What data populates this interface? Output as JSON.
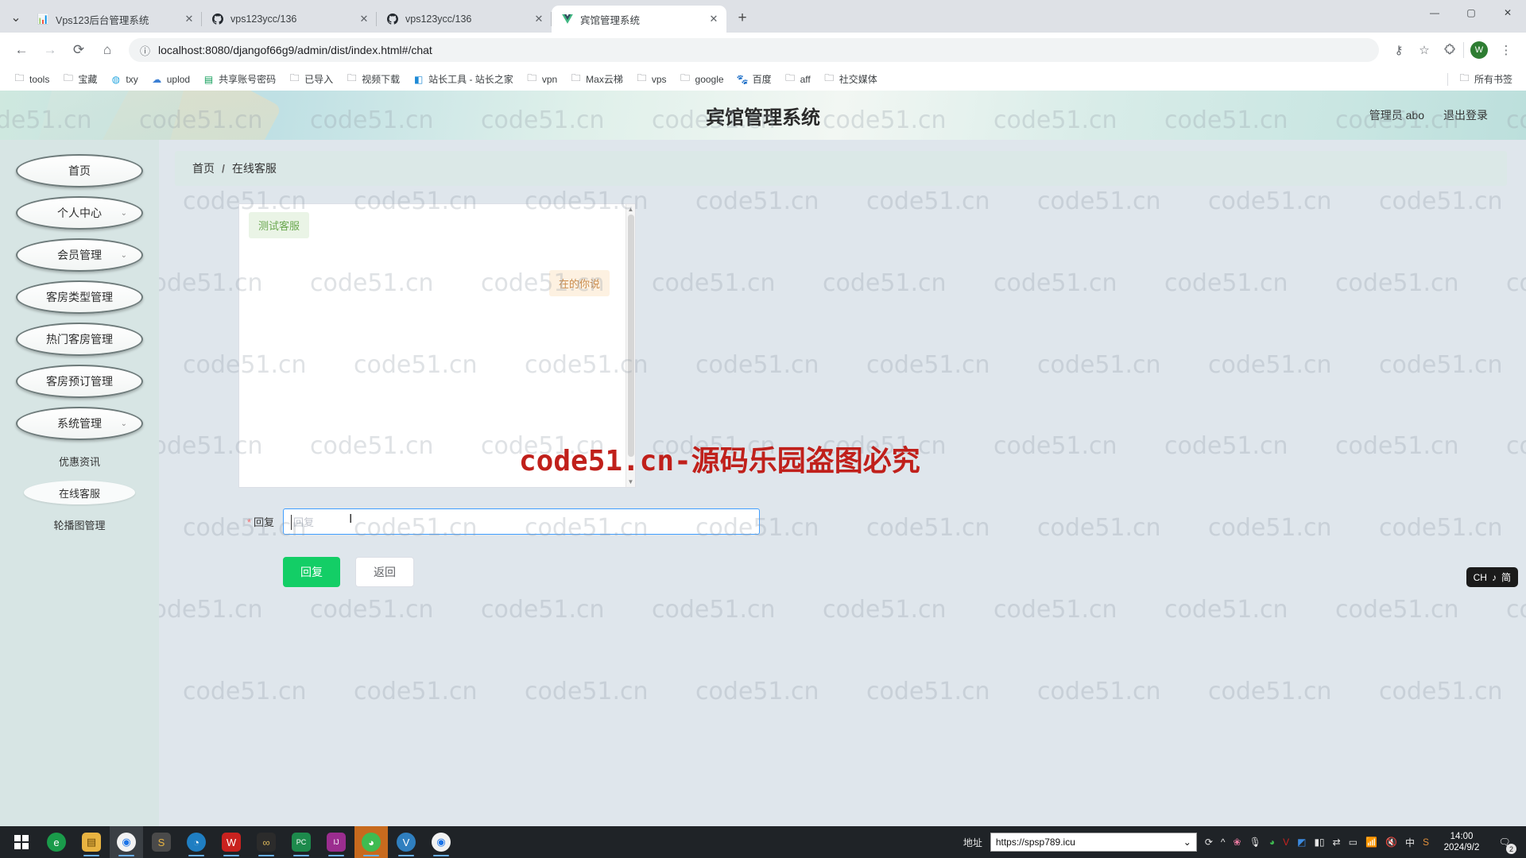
{
  "browser": {
    "tabs": [
      {
        "title": "Vps123后台管理系统",
        "favicon": "chart-icon",
        "active": false,
        "close": "✕"
      },
      {
        "title": "vps123ycc/136",
        "favicon": "github-icon",
        "active": false,
        "close": "✕"
      },
      {
        "title": "vps123ycc/136",
        "favicon": "github-icon",
        "active": false,
        "close": "✕"
      },
      {
        "title": "宾馆管理系统",
        "favicon": "vue-icon",
        "active": true,
        "close": "✕"
      }
    ],
    "new_tab_label": "+",
    "window_controls": {
      "minimize": "—",
      "maximize": "▢",
      "close": "✕"
    },
    "nav": {
      "back": "←",
      "forward": "→",
      "reload": "⟳",
      "home": "⌂"
    },
    "omnibox": {
      "info_icon": "ⓘ",
      "url": "localhost:8080/djangof66g9/admin/dist/index.html#/chat"
    },
    "toolbar_right": {
      "password_icon": "⚷",
      "bookmark_icon": "☆",
      "extensions_icon": "🧩",
      "profile_initial": "W",
      "menu_icon": "⋮"
    },
    "bookmarks": [
      {
        "label": "tools",
        "icon": "folder-icon"
      },
      {
        "label": "宝藏",
        "icon": "folder-icon"
      },
      {
        "label": "txy",
        "icon": "tencent-icon"
      },
      {
        "label": "uplod",
        "icon": "cloud-icon"
      },
      {
        "label": "共享账号密码",
        "icon": "sheet-icon"
      },
      {
        "label": "已导入",
        "icon": "folder-icon"
      },
      {
        "label": "视频下载",
        "icon": "folder-icon"
      },
      {
        "label": "站长工具 - 站长之家",
        "icon": "chinaz-icon"
      },
      {
        "label": "vpn",
        "icon": "folder-icon"
      },
      {
        "label": "Max云梯",
        "icon": "folder-icon"
      },
      {
        "label": "vps",
        "icon": "folder-icon"
      },
      {
        "label": "google",
        "icon": "folder-icon"
      },
      {
        "label": "百度",
        "icon": "baidu-icon"
      },
      {
        "label": "aff",
        "icon": "folder-icon"
      },
      {
        "label": "社交媒体",
        "icon": "folder-icon"
      }
    ],
    "all_bookmarks": {
      "label": "所有书签",
      "icon": "folder-icon"
    }
  },
  "app": {
    "header": {
      "title": "宾馆管理系统",
      "user_label": "管理员 abo",
      "logout_label": "退出登录"
    },
    "sidebar": {
      "items": [
        {
          "label": "首页",
          "has_arrow": false
        },
        {
          "label": "个人中心",
          "has_arrow": true
        },
        {
          "label": "会员管理",
          "has_arrow": true
        },
        {
          "label": "客房类型管理",
          "has_arrow": false
        },
        {
          "label": "热门客房管理",
          "has_arrow": false
        },
        {
          "label": "客房预订管理",
          "has_arrow": false
        },
        {
          "label": "系统管理",
          "has_arrow": true
        }
      ],
      "sub_items": [
        {
          "label": "优惠资讯",
          "active": false
        },
        {
          "label": "在线客服",
          "active": true
        },
        {
          "label": "轮播图管理",
          "active": false
        }
      ],
      "arrow_glyph": "⌄"
    },
    "breadcrumb": {
      "home": "首页",
      "separator": "/",
      "current": "在线客服"
    },
    "chat": {
      "messages": [
        {
          "text": "测试客服",
          "side": "left"
        },
        {
          "text": "在的你说",
          "side": "right"
        }
      ],
      "scroll_up": "▲",
      "scroll_down": "▼"
    },
    "form": {
      "required_mark": "*",
      "reply_label": "回复",
      "reply_placeholder": "回复",
      "reply_value": "",
      "submit_label": "回复",
      "back_label": "返回"
    },
    "watermark": {
      "tile_text": "code51.cn",
      "red_text": "code51.cn-源码乐园盗图必究"
    },
    "ime_badge": {
      "lang": "CH",
      "music": "♪",
      "mode": "简"
    }
  },
  "taskbar": {
    "start_icon": "windows-icon",
    "apps": [
      {
        "name": "ie-icon",
        "glyph": "e",
        "bg": "#1a9b4a",
        "open": false,
        "highlight": false
      },
      {
        "name": "explorer-icon",
        "glyph": "🗂",
        "bg": "#e8b341",
        "open": true,
        "highlight": false
      },
      {
        "name": "chrome-icon",
        "glyph": "◉",
        "bg": "#f2f2f2",
        "open": true,
        "highlight": true
      },
      {
        "name": "sublime-icon",
        "glyph": "S",
        "bg": "#4a4a4a",
        "open": false,
        "highlight": false
      },
      {
        "name": "edge-icon",
        "glyph": "◔",
        "bg": "#1f7ec2",
        "open": true,
        "highlight": false
      },
      {
        "name": "wps-icon",
        "glyph": "W",
        "bg": "#c9221f",
        "open": true,
        "highlight": false
      },
      {
        "name": "navicat-icon",
        "glyph": "∞",
        "bg": "#2b2b2b",
        "open": true,
        "highlight": false
      },
      {
        "name": "pycharm-icon",
        "glyph": "PC",
        "bg": "#1d8a4c",
        "open": true,
        "highlight": false
      },
      {
        "name": "idea-icon",
        "glyph": "IJ",
        "bg": "#9b2d8f",
        "open": true,
        "highlight": false
      },
      {
        "name": "wechat-icon",
        "glyph": "💬",
        "bg": "#3fbb51",
        "open": true,
        "highlight": true
      },
      {
        "name": "yy-icon",
        "glyph": "V",
        "bg": "#2f7fbf",
        "open": true,
        "highlight": false
      },
      {
        "name": "chrome2-icon",
        "glyph": "◉",
        "bg": "#f2f2f2",
        "open": true,
        "highlight": false
      }
    ],
    "address": {
      "label": "地址",
      "value": "https://spsp789.icu",
      "dropdown": "⌄",
      "refresh": "⟳"
    },
    "tray_icons": [
      "^",
      "🌸",
      "🎙",
      "👤",
      "V",
      "1",
      "M",
      "⇄"
    ],
    "status_icons": [
      "🖥",
      "📶",
      "🔇",
      "中",
      "S"
    ],
    "clock": {
      "time": "14:00",
      "date": "2024/9/2"
    },
    "notification": {
      "icon": "💬",
      "count": "2"
    }
  }
}
